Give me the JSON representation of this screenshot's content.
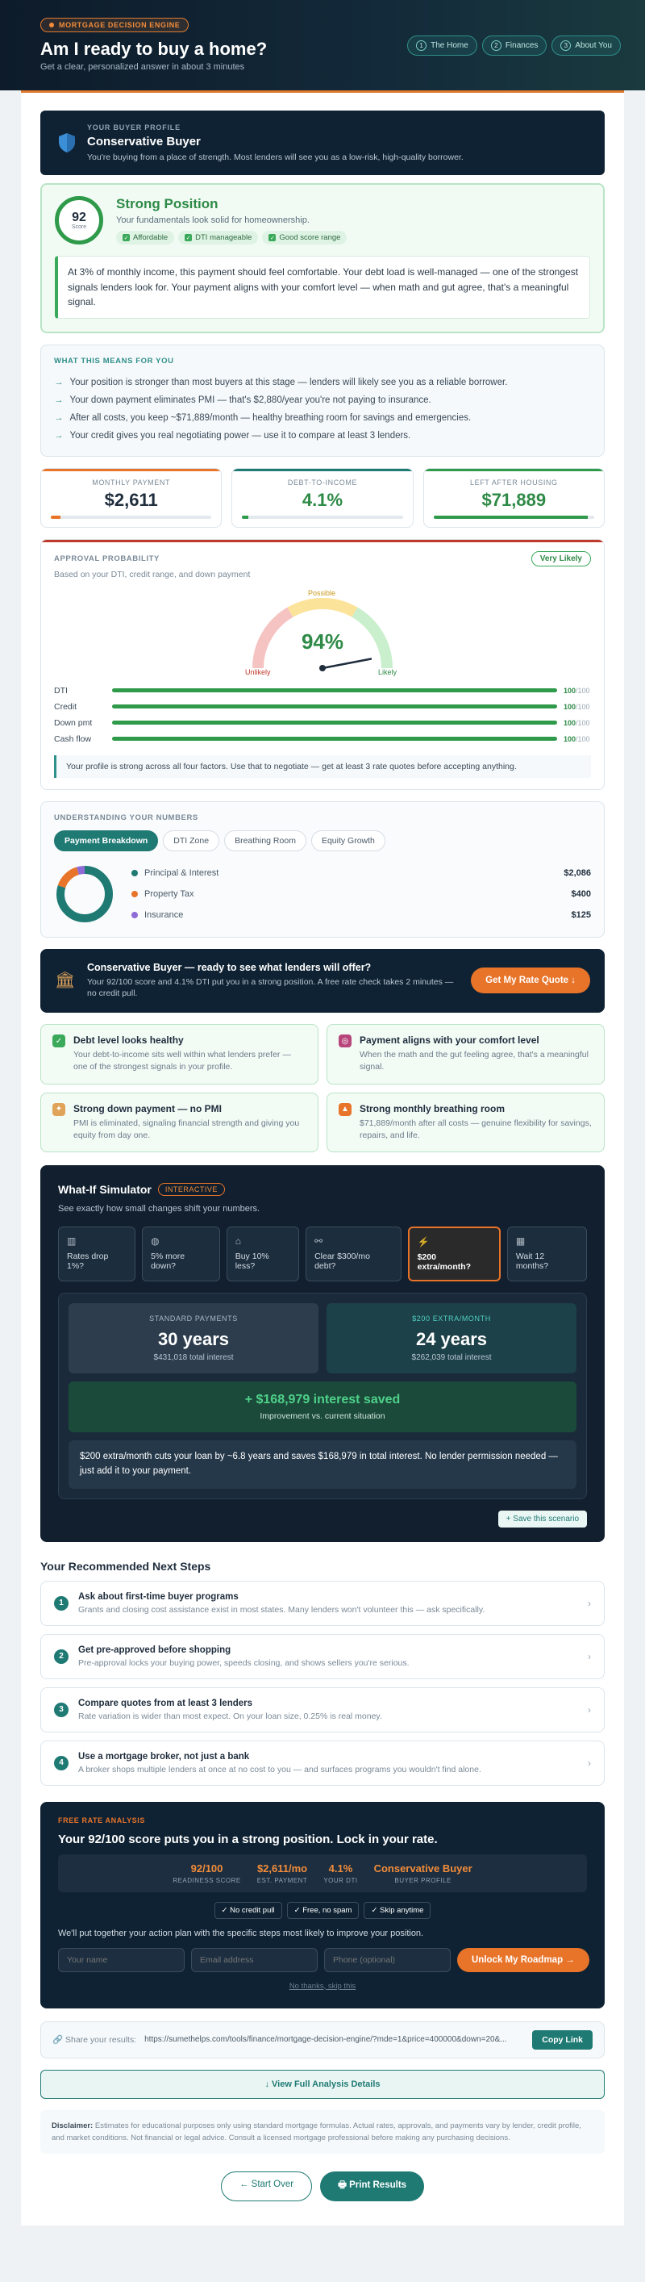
{
  "header": {
    "badge": "MORTGAGE DECISION ENGINE",
    "title": "Am I ready to buy a home?",
    "subtitle": "Get a clear, personalized answer in about 3 minutes",
    "nav": [
      {
        "num": "1",
        "label": "The Home"
      },
      {
        "num": "2",
        "label": "Finances"
      },
      {
        "num": "3",
        "label": "About You"
      }
    ]
  },
  "profile": {
    "label": "YOUR BUYER PROFILE",
    "title": "Conservative Buyer",
    "desc": "You're buying from a place of strength. Most lenders will see you as a low-risk, high-quality borrower."
  },
  "position": {
    "score": "92",
    "score_label": "Score",
    "title": "Strong Position",
    "desc": "Your fundamentals look solid for homeownership.",
    "tags": [
      "Affordable",
      "DTI manageable",
      "Good score range"
    ],
    "quote": "At 3% of monthly income, this payment should feel comfortable. Your debt load is well-managed — one of the strongest signals lenders look for. Your payment aligns with your comfort level — when math and gut agree, that's a meaningful signal."
  },
  "means": {
    "label": "WHAT THIS MEANS FOR YOU",
    "items": [
      "Your position is stronger than most buyers at this stage — lenders will likely see you as a reliable borrower.",
      "Your down payment eliminates PMI — that's $2,880/year you're not paying to insurance.",
      "After all costs, you keep ~$71,889/month — healthy breathing room for savings and emergencies.",
      "Your credit gives you real negotiating power — use it to compare at least 3 lenders."
    ]
  },
  "stats": [
    {
      "label": "MONTHLY PAYMENT",
      "value": "$2,611",
      "color": "#1f2d3d",
      "accent": "#e8742a",
      "fill": 0.06
    },
    {
      "label": "DEBT-TO-INCOME",
      "value": "4.1%",
      "color": "#2e8a46",
      "accent": "#1f7a74",
      "fill": 0.04
    },
    {
      "label": "LEFT AFTER HOUSING",
      "value": "$71,889",
      "color": "#2e8a46",
      "accent": "#2e9a4a",
      "fill": 0.96
    }
  ],
  "approval": {
    "title": "APPROVAL PROBABILITY",
    "badge": "Very Likely",
    "based": "Based on your DTI, credit range, and down payment",
    "pct": "94%",
    "pct_value": 94,
    "label_possible": "Possible",
    "label_unlikely": "Unlikely",
    "label_likely": "Likely",
    "factors": [
      {
        "name": "DTI",
        "value": 100,
        "text": "100",
        "max": "/100"
      },
      {
        "name": "Credit",
        "value": 100,
        "text": "100",
        "max": "/100"
      },
      {
        "name": "Down pmt",
        "value": 100,
        "text": "100",
        "max": "/100"
      },
      {
        "name": "Cash flow",
        "value": 100,
        "text": "100",
        "max": "/100"
      }
    ],
    "note": "Your profile is strong across all four factors. Use that to negotiate — get at least 3 rate quotes before accepting anything."
  },
  "understand": {
    "label": "UNDERSTANDING YOUR NUMBERS",
    "tabs": [
      "Payment Breakdown",
      "DTI Zone",
      "Breathing Room",
      "Equity Growth"
    ],
    "breakdown": [
      {
        "name": "Principal & Interest",
        "value": "$2,086",
        "amount": 2086,
        "color": "#1f7a74"
      },
      {
        "name": "Property Tax",
        "value": "$400",
        "amount": 400,
        "color": "#e8742a"
      },
      {
        "name": "Insurance",
        "value": "$125",
        "amount": 125,
        "color": "#8e6bd6"
      }
    ]
  },
  "cta": {
    "title": "Conservative Buyer — ready to see what lenders will offer?",
    "desc": "Your 92/100 score and 4.1% DTI put you in a strong position. A free rate check takes 2 minutes — no credit pull.",
    "button": "Get My Rate Quote ↓"
  },
  "cards": [
    {
      "title": "Debt level looks healthy",
      "desc": "Your debt-to-income sits well within what lenders prefer — one of the strongest signals in your profile.",
      "color": "#3aa95a",
      "icon": "✓"
    },
    {
      "title": "Payment aligns with your comfort level",
      "desc": "When the math and the gut feeling agree, that's a meaningful signal.",
      "color": "#b8457a",
      "icon": "◎"
    },
    {
      "title": "Strong down payment — no PMI",
      "desc": "PMI is eliminated, signaling financial strength and giving you equity from day one.",
      "color": "#e0a35a",
      "icon": "✦"
    },
    {
      "title": "Strong monthly breathing room",
      "desc": "$71,889/month after all costs — genuine flexibility for savings, repairs, and life.",
      "color": "#e8742a",
      "icon": "▲"
    }
  ],
  "sim": {
    "title": "What-If Simulator",
    "badge": "INTERACTIVE",
    "desc": "See exactly how small changes shift your numbers.",
    "scenarios": [
      "Rates drop 1%?",
      "5% more down?",
      "Buy 10% less?",
      "Clear $300/mo debt?",
      "$200 extra/month?",
      "Wait 12 months?"
    ],
    "standard_label": "STANDARD PAYMENTS",
    "standard_years": "30 years",
    "standard_interest": "$431,018 total interest",
    "extra_label": "$200 EXTRA/MONTH",
    "extra_years": "24 years",
    "extra_interest": "$262,039 total interest",
    "saved": "+ $168,979 interest saved",
    "saved_sub": "Improvement vs. current situation",
    "explain": "$200 extra/month cuts your loan by ~6.8 years and saves $168,979 in total interest. No lender permission needed — just add it to your payment.",
    "save_btn": "+ Save this scenario"
  },
  "steps": {
    "title": "Your Recommended Next Steps",
    "items": [
      {
        "n": "1",
        "t": "Ask about first-time buyer programs",
        "d": "Grants and closing cost assistance exist in most states. Many lenders won't volunteer this — ask specifically."
      },
      {
        "n": "2",
        "t": "Get pre-approved before shopping",
        "d": "Pre-approval locks your buying power, speeds closing, and shows sellers you're serious."
      },
      {
        "n": "3",
        "t": "Compare quotes from at least 3 lenders",
        "d": "Rate variation is wider than most expect. On your loan size, 0.25% is real money."
      },
      {
        "n": "4",
        "t": "Use a mortgage broker, not just a bank",
        "d": "A broker shops multiple lenders at once at no cost to you — and surfaces programs you wouldn't find alone."
      }
    ]
  },
  "lead": {
    "flag": "FREE RATE ANALYSIS",
    "title": "Your 92/100 score puts you in a strong position. Lock in your rate.",
    "metrics": [
      {
        "v": "92/100",
        "k": "READINESS SCORE"
      },
      {
        "v": "$2,611/mo",
        "k": "EST. PAYMENT"
      },
      {
        "v": "4.1%",
        "k": "YOUR DTI"
      },
      {
        "v": "Conservative Buyer",
        "k": "BUYER PROFILE"
      }
    ],
    "chips": [
      "✓ No credit pull",
      "✓ Free, no spam",
      "✓ Skip anytime"
    ],
    "pitch": "We'll put together your action plan with the specific steps most likely to improve your position.",
    "name_ph": "Your name",
    "email_ph": "Email address",
    "phone_ph": "Phone (optional)",
    "button": "Unlock My Roadmap →",
    "skip": "No thanks, skip this"
  },
  "share": {
    "label": "Share your results:",
    "url": "https://sumethelps.com/tools/finance/mortgage-decision-engine/?mde=1&price=400000&down=20&...",
    "copy": "Copy Link"
  },
  "full": "↓ View Full Analysis Details",
  "disclaimer_b": "Disclaimer:",
  "disclaimer": " Estimates for educational purposes only using standard mortgage formulas. Actual rates, approvals, and payments vary by lender, credit profile, and market conditions. Not financial or legal advice. Consult a licensed mortgage professional before making any purchasing decisions.",
  "bottom": {
    "start_over": "← Start Over",
    "print": "🖶 Print Results"
  }
}
